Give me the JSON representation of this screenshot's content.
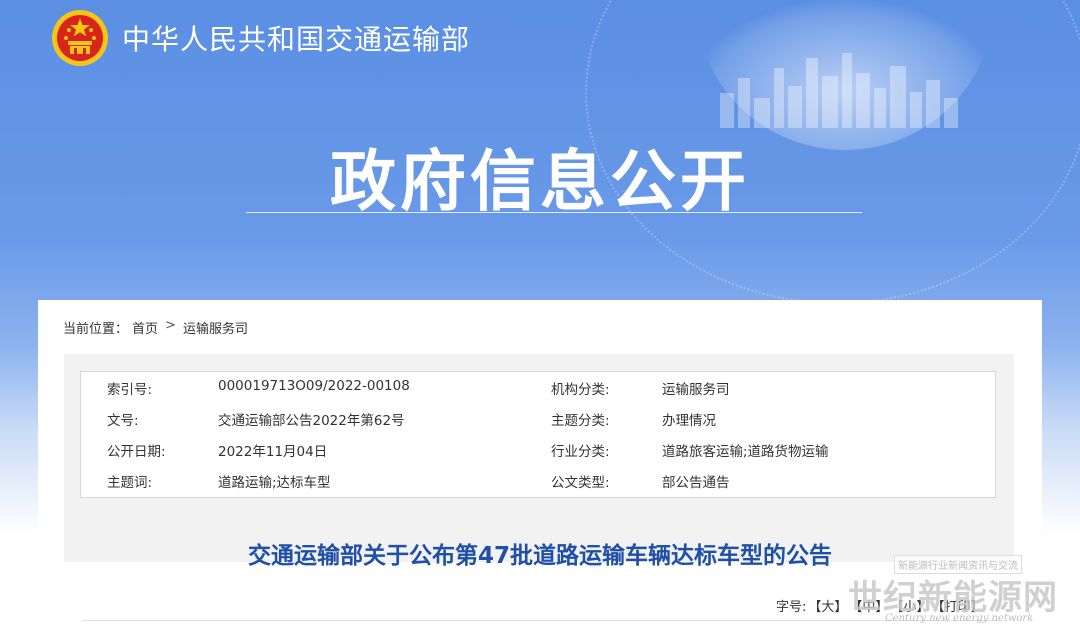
{
  "header": {
    "ministry_name": "中华人民共和国交通运输部",
    "section_title": "政府信息公开"
  },
  "breadcrumb": {
    "prefix": "当前位置：",
    "items": [
      "首页",
      "运输服务司"
    ],
    "separator": ">"
  },
  "metadata": {
    "rows": [
      {
        "label1": "索引号:",
        "value1": "000019713O09/2022-00108",
        "label2": "机构分类:",
        "value2": "运输服务司"
      },
      {
        "label1": "文号:",
        "value1": "交通运输部公告2022年第62号",
        "label2": "主题分类:",
        "value2": "办理情况"
      },
      {
        "label1": "公开日期:",
        "value1": "2022年11月04日",
        "label2": "行业分类:",
        "value2": "道路旅客运输;道路货物运输"
      },
      {
        "label1": "主题词:",
        "value1": "道路运输;达标车型",
        "label2": "公文类型:",
        "value2": "部公告通告"
      }
    ]
  },
  "article": {
    "title": "交通运输部关于公布第47批道路运输车辆达标车型的公告"
  },
  "font_size": {
    "label": "字号:",
    "options": [
      "【大】",
      "【中】",
      "【小】",
      "【打印】"
    ]
  },
  "watermark": {
    "text": "世纪新能源网",
    "tag": "新能源行业新闻资讯与交流",
    "subtext": "Century new energy network"
  },
  "colors": {
    "hero_blue": "#5b8fe3",
    "title_blue": "#204fa8",
    "emblem_red": "#d7251d",
    "emblem_gold": "#f5c518"
  },
  "icons": {
    "emblem": "national-emblem-icon"
  }
}
